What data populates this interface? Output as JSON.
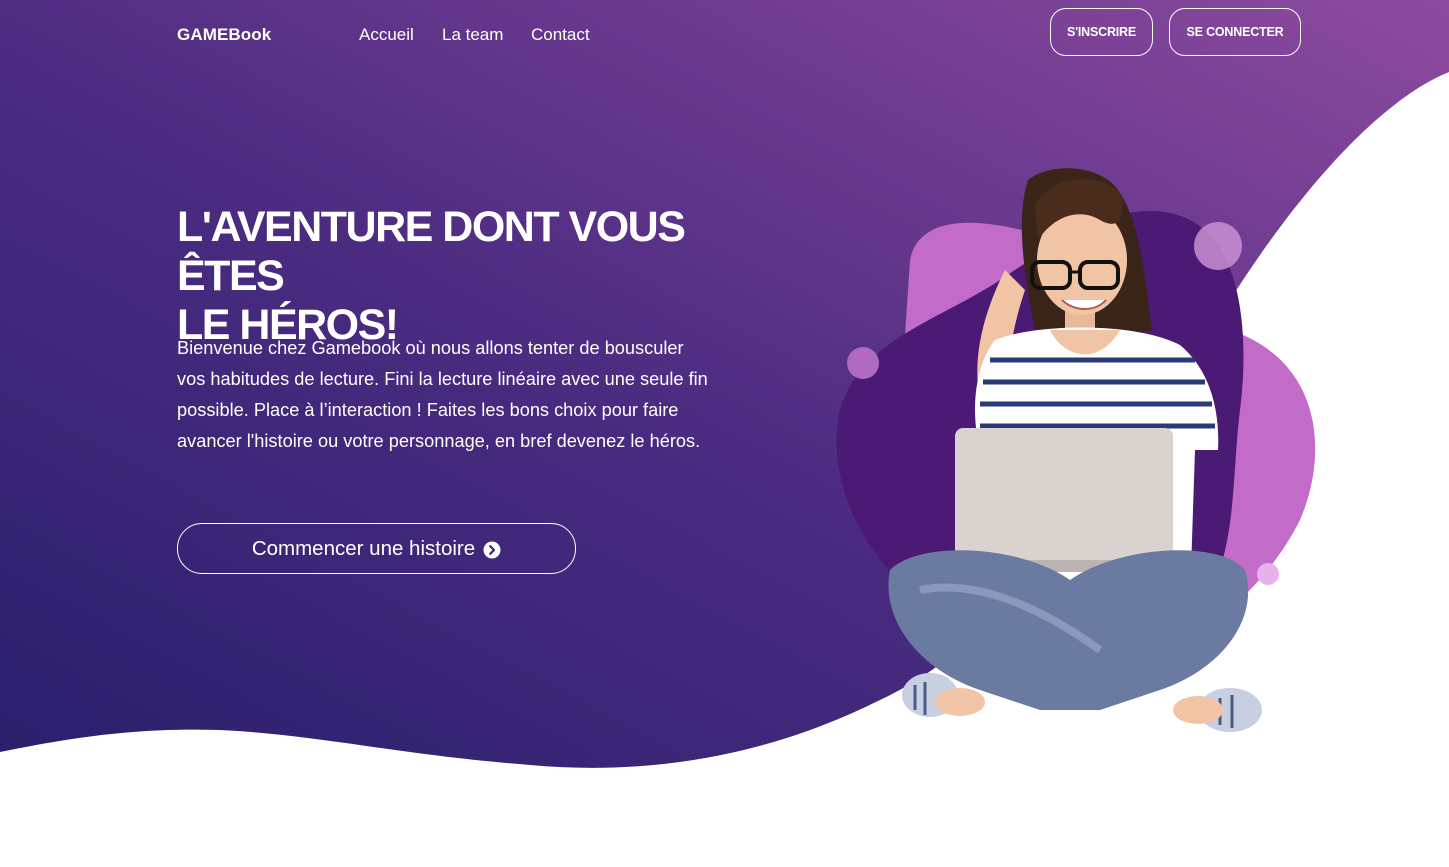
{
  "brand": {
    "name": "GAMEBook"
  },
  "nav": {
    "links": [
      "Accueil",
      "La team",
      "Contact"
    ],
    "register_label": "S'INSCRIRE",
    "login_label": "SE CONNECTER"
  },
  "hero": {
    "title_line1": "L'AVENTURE DONT VOUS ÊTES",
    "title_line2": "LE HÉROS!",
    "intro_lines": [
      "Bienvenue chez Gamebook où nous allons tenter de bousculer",
      "vos habitudes de lecture. Fini la lecture linéaire avec une seule fin",
      "possible. Place à l’interaction ! Faites les bons choix pour faire",
      "avancer l'histoire ou votre personnage, en bref devenez le héros."
    ],
    "cta_label": "Commencer une histoire",
    "cta_icon": "chevron-right-circle-icon"
  },
  "colors": {
    "gradient_start": "#2c1f6e",
    "gradient_end": "#8a4aa2",
    "blob_dark": "#4a1a73",
    "blob_pink": "#c66fc9",
    "blob_light": "#e8b3ec"
  }
}
